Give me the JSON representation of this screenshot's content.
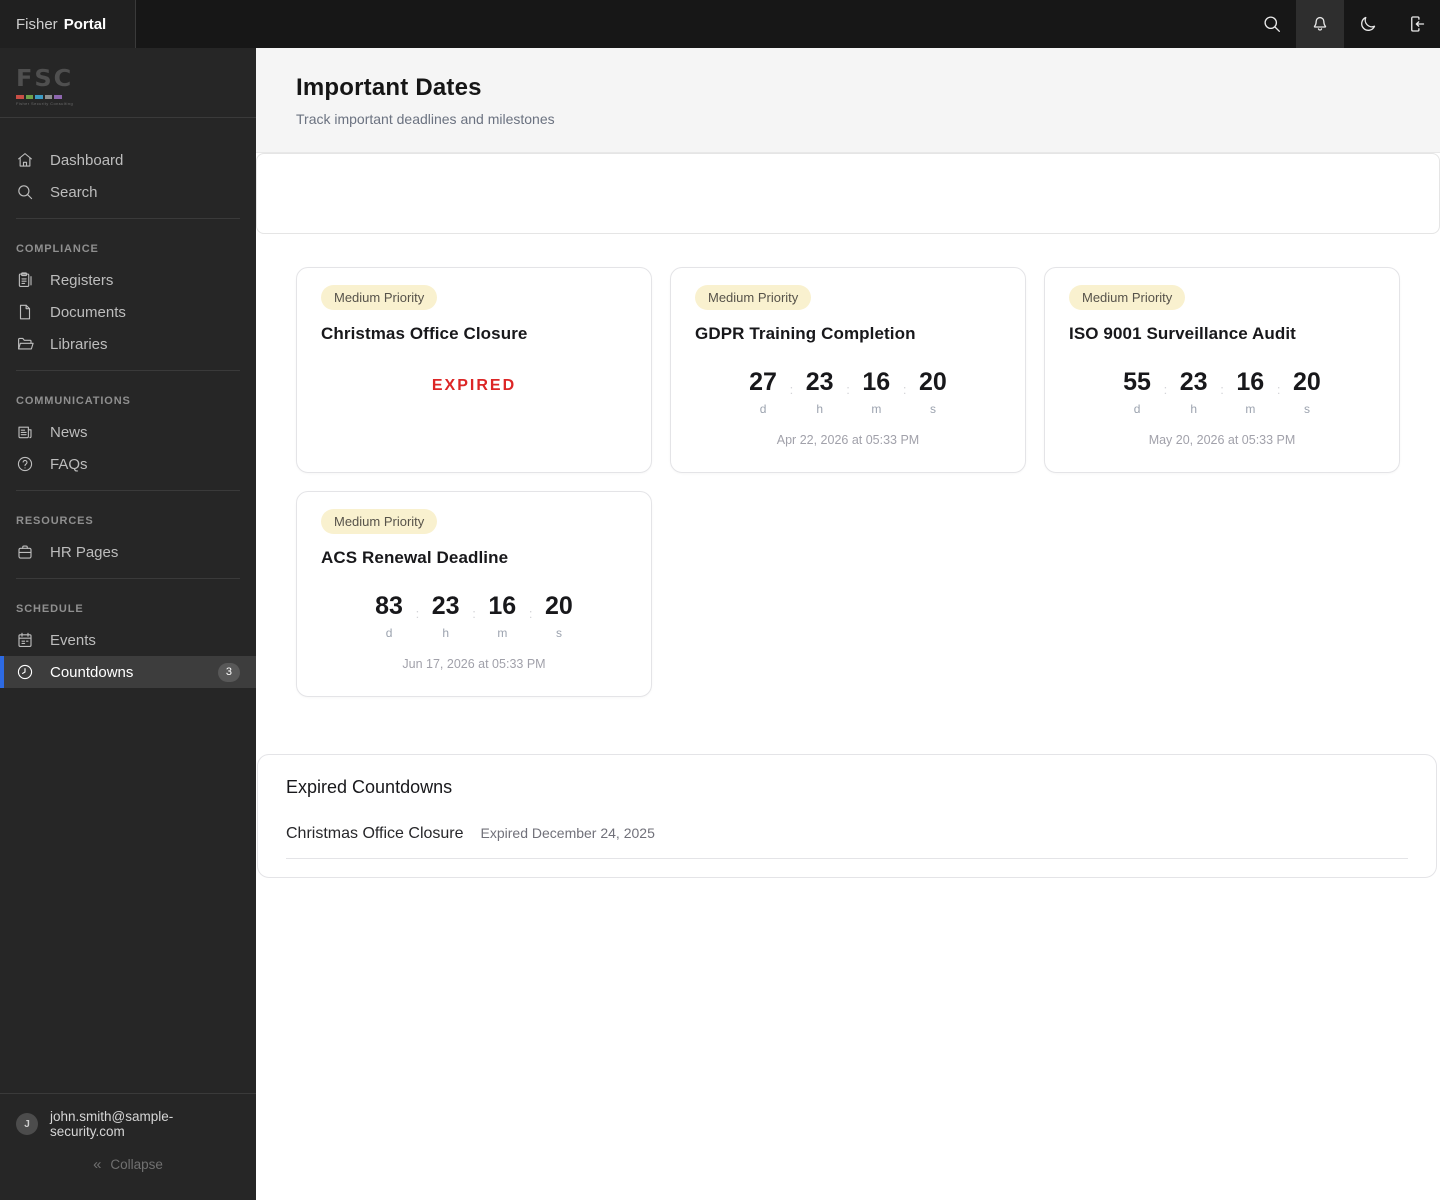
{
  "brand": {
    "name_light": "Fisher",
    "name_bold": "Portal"
  },
  "topbar": {
    "actions": [
      {
        "name": "search",
        "icon": "search-icon",
        "active": false
      },
      {
        "name": "notifications",
        "icon": "bell-icon",
        "active": true
      },
      {
        "name": "dark-mode",
        "icon": "moon-icon",
        "active": false
      },
      {
        "name": "sign-in",
        "icon": "login-icon",
        "active": false
      }
    ]
  },
  "sidebar": {
    "logo": {
      "text": "FSC",
      "tagline": "Fisher Security Consulting",
      "bar_colors": [
        "#c94f46",
        "#6fa24a",
        "#3d9bc4",
        "#8f8f8f",
        "#8d66ae"
      ]
    },
    "sections": [
      {
        "label": "",
        "items": [
          {
            "label": "Dashboard",
            "icon": "home-icon"
          },
          {
            "label": "Search",
            "icon": "search-icon"
          }
        ]
      },
      {
        "label": "COMPLIANCE",
        "items": [
          {
            "label": "Registers",
            "icon": "registers-icon"
          },
          {
            "label": "Documents",
            "icon": "document-icon"
          },
          {
            "label": "Libraries",
            "icon": "folder-icon"
          }
        ]
      },
      {
        "label": "COMMUNICATIONS",
        "items": [
          {
            "label": "News",
            "icon": "news-icon"
          },
          {
            "label": "FAQs",
            "icon": "help-icon"
          }
        ]
      },
      {
        "label": "RESOURCES",
        "items": [
          {
            "label": "HR Pages",
            "icon": "briefcase-icon"
          }
        ]
      },
      {
        "label": "SCHEDULE",
        "items": [
          {
            "label": "Events",
            "icon": "calendar-icon"
          },
          {
            "label": "Countdowns",
            "icon": "clock-icon",
            "active": true,
            "badge": "3"
          }
        ]
      }
    ],
    "user": {
      "initial": "J",
      "email": "john.smith@sample-security.com"
    },
    "collapse_label": "Collapse"
  },
  "page": {
    "title": "Important Dates",
    "subtitle": "Track important deadlines and milestones"
  },
  "countdown_units": [
    "d",
    "h",
    "m",
    "s"
  ],
  "cards": [
    {
      "priority": "Medium Priority",
      "title": "Christmas Office Closure",
      "expired": true,
      "expired_label": "EXPIRED"
    },
    {
      "priority": "Medium Priority",
      "title": "GDPR Training Completion",
      "countdown": [
        "27",
        "23",
        "16",
        "20"
      ],
      "target": "Apr 22, 2026 at 05:33 PM"
    },
    {
      "priority": "Medium Priority",
      "title": "ISO 9001 Surveillance Audit",
      "countdown": [
        "55",
        "23",
        "16",
        "20"
      ],
      "target": "May 20, 2026 at 05:33 PM"
    },
    {
      "priority": "Medium Priority",
      "title": "ACS Renewal Deadline",
      "countdown": [
        "83",
        "23",
        "16",
        "20"
      ],
      "target": "Jun 17, 2026 at 05:33 PM"
    }
  ],
  "expired_section": {
    "title": "Expired Countdowns",
    "rows": [
      {
        "title": "Christmas Office Closure",
        "status": "Expired December 24, 2025"
      }
    ]
  },
  "colors": {
    "accent_blue": "#2d6ae3",
    "priority_bg": "#f9f1cf",
    "priority_text": "#57534a",
    "expired_red": "#dc2626",
    "topbar_bg": "#171717",
    "sidebar_bg": "#262626"
  }
}
